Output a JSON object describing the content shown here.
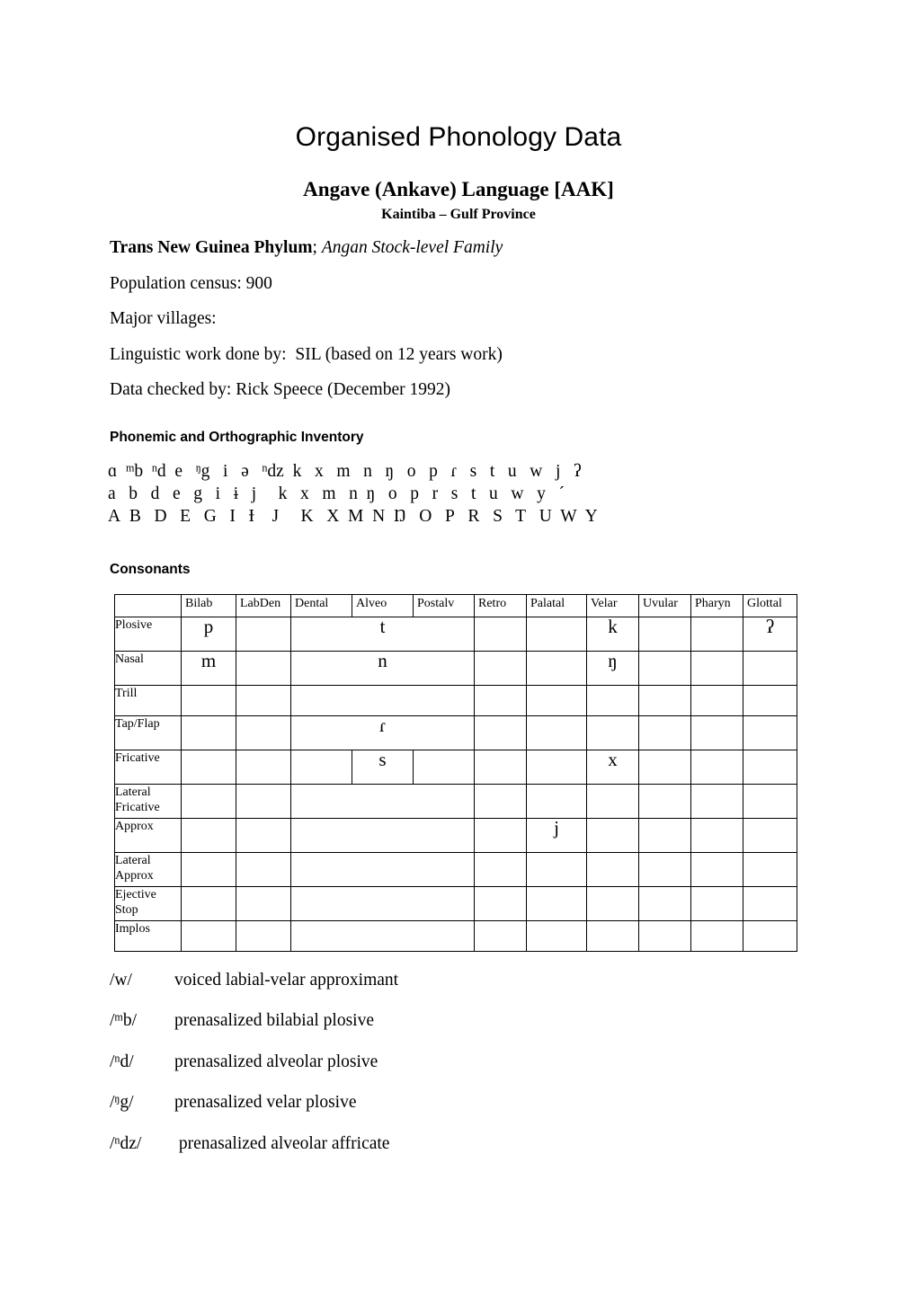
{
  "document": {
    "title": "Organised Phonology Data",
    "language_title": "Angave (Ankave) Language  [AAK]",
    "location": "Kaintiba –  Gulf Province"
  },
  "meta": {
    "phylum_bold": "Trans New Guinea Phylum",
    "phylum_sep": "; ",
    "family_italic": "Angan Stock-level Family",
    "population": "Population census: 900",
    "villages": "Major villages:",
    "linguistic_work": "Linguistic work done by:  SIL (based on 12 years work)",
    "data_checked": "Data checked by: Rick Speece (December 1992)"
  },
  "inventory": {
    "heading": "Phonemic and Orthographic Inventory",
    "ipa_row": [
      "ɑ",
      "ᵐb",
      "ⁿd",
      "e",
      "ᵑg",
      "i",
      "ə",
      "ⁿdz",
      "k",
      "x",
      "m",
      "n",
      "ŋ",
      "o",
      "p",
      "ɾ",
      "s",
      "t",
      "u",
      "w",
      "j",
      "ʔ"
    ],
    "lower_row": [
      "a",
      "b",
      "d",
      "e",
      "g",
      "i",
      "ɨ",
      "j",
      "k",
      "x",
      "m",
      "n",
      "ŋ",
      "o",
      "p",
      "r",
      "s",
      "t",
      "u",
      "w",
      "y",
      "´"
    ],
    "upper_row": [
      "A",
      "B",
      "D",
      "E",
      "G",
      "I",
      "Ɨ",
      "J",
      "K",
      "X",
      "M",
      "N",
      "Ŋ",
      "O",
      "P",
      "R",
      "S",
      "T",
      "U",
      "W",
      "Y"
    ],
    "ipa_row_text": "ɑ  ᵐb  ⁿd  e   ᵑg   i   ə   ⁿdz  k   x   m   n   ŋ   o   p   ɾ   s   t   u   w   j   ʔ",
    "lower_row_text": "a   b   d   e   g   i   ɨ   j     k   x   m  n  ŋ   o   p   r   s   t   u   w   y   ´",
    "upper_row_text": "A  B   D   E   G   I   Ɨ    J     K   X  M  N  Ŋ   O   P   R   S   T   U  W  Y"
  },
  "consonants": {
    "heading": "Consonants",
    "columns": [
      "",
      "Bilab",
      "LabDen",
      "Dental",
      "Alveo",
      "Postalv",
      "Retro",
      "Palatal",
      "Velar",
      "Uvular",
      "Pharyn",
      "Glottal"
    ],
    "rows": [
      {
        "label": "Plosive",
        "merged_coronal": true,
        "cells": {
          "Bilab": "p",
          "LabDen": "",
          "Coronal": "t",
          "Retro": "",
          "Palatal": "",
          "Velar": "k",
          "Uvular": "",
          "Pharyn": "",
          "Glottal": "ʔ"
        }
      },
      {
        "label": "Nasal",
        "merged_coronal": true,
        "cells": {
          "Bilab": "m",
          "LabDen": "",
          "Coronal": "n",
          "Retro": "",
          "Palatal": "",
          "Velar": "ŋ",
          "Uvular": "",
          "Pharyn": "",
          "Glottal": ""
        }
      },
      {
        "label": "Trill",
        "merged_coronal": true,
        "cells": {
          "Bilab": "",
          "LabDen": "",
          "Coronal": "",
          "Retro": "",
          "Palatal": "",
          "Velar": "",
          "Uvular": "",
          "Pharyn": "",
          "Glottal": ""
        }
      },
      {
        "label": "Tap/Flap",
        "merged_coronal": true,
        "cells": {
          "Bilab": "",
          "LabDen": "",
          "Coronal": "ɾ",
          "Retro": "",
          "Palatal": "",
          "Velar": "",
          "Uvular": "",
          "Pharyn": "",
          "Glottal": ""
        }
      },
      {
        "label": "Fricative",
        "merged_coronal": false,
        "cells": {
          "Bilab": "",
          "LabDen": "",
          "Dental": "",
          "Alveo": "s",
          "Postalv": "",
          "Retro": "",
          "Palatal": "",
          "Velar": "x",
          "Uvular": "",
          "Pharyn": "",
          "Glottal": ""
        }
      },
      {
        "label": "Lateral Fricative",
        "label_line1": "Lateral",
        "label_line2": "Fricative",
        "merged_coronal": true,
        "cells": {
          "Bilab": "",
          "LabDen": "",
          "Coronal": "",
          "Retro": "",
          "Palatal": "",
          "Velar": "",
          "Uvular": "",
          "Pharyn": "",
          "Glottal": ""
        }
      },
      {
        "label": "Approx",
        "merged_coronal": true,
        "cells": {
          "Bilab": "",
          "LabDen": "",
          "Coronal": "",
          "Retro": "",
          "Palatal": "j",
          "Velar": "",
          "Uvular": "",
          "Pharyn": "",
          "Glottal": ""
        }
      },
      {
        "label": "Lateral Approx",
        "label_line1": "Lateral",
        "label_line2": "Approx",
        "merged_coronal": true,
        "cells": {
          "Bilab": "",
          "LabDen": "",
          "Coronal": "",
          "Retro": "",
          "Palatal": "",
          "Velar": "",
          "Uvular": "",
          "Pharyn": "",
          "Glottal": ""
        }
      },
      {
        "label": "Ejective Stop",
        "label_line1": "Ejective",
        "label_line2": "Stop",
        "merged_coronal": true,
        "cells": {
          "Bilab": "",
          "LabDen": "",
          "Coronal": "",
          "Retro": "",
          "Palatal": "",
          "Velar": "",
          "Uvular": "",
          "Pharyn": "",
          "Glottal": ""
        }
      },
      {
        "label": "Implos",
        "merged_coronal": true,
        "cells": {
          "Bilab": "",
          "LabDen": "",
          "Coronal": "",
          "Retro": "",
          "Palatal": "",
          "Velar": "",
          "Uvular": "",
          "Pharyn": "",
          "Glottal": ""
        }
      }
    ]
  },
  "notes": [
    {
      "symbol": "/w/",
      "description": "voiced labial-velar approximant"
    },
    {
      "symbol": "/ᵐb/",
      "description": "prenasalized bilabial plosive"
    },
    {
      "symbol": "/ⁿd/",
      "description": "prenasalized alveolar plosive"
    },
    {
      "symbol": "/ᵑg/",
      "description": "prenasalized velar plosive"
    },
    {
      "symbol": "/ⁿdz/",
      "description": " prenasalized alveolar affricate"
    }
  ]
}
